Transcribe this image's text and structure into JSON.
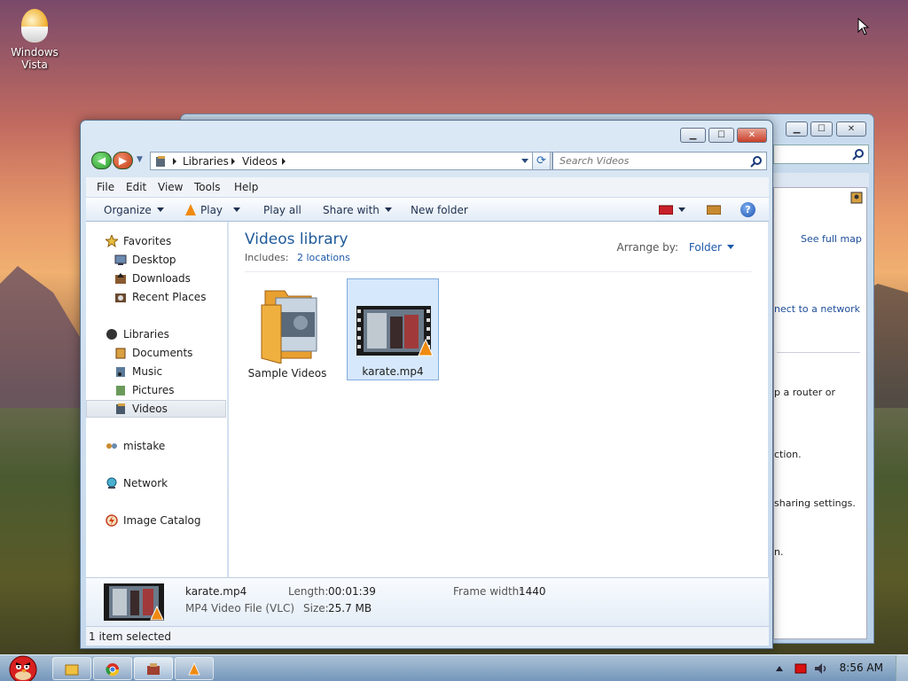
{
  "desktop": {
    "icons": [
      {
        "label": "Windows\nVista",
        "line1": "Windows",
        "line2": "Vista"
      }
    ]
  },
  "background_window": {
    "texts": [
      "See full map",
      "nect to a network",
      "p a router or",
      "ction.",
      "sharing settings.",
      "n."
    ]
  },
  "window": {
    "caption_buttons": {
      "minimize": "▁",
      "maximize": "☐",
      "close": "✕"
    },
    "address": {
      "crumbs": [
        "Libraries",
        "Videos"
      ]
    },
    "search": {
      "placeholder": "Search Videos"
    },
    "menu": [
      "File",
      "Edit",
      "View",
      "Tools",
      "Help"
    ],
    "toolbar": {
      "organize": "Organize",
      "play": "Play",
      "play_all": "Play all",
      "share_with": "Share with",
      "new_folder": "New folder",
      "help": "?"
    },
    "nav": {
      "favorites": "Favorites",
      "favorites_items": [
        "Desktop",
        "Downloads",
        "Recent Places"
      ],
      "libraries": "Libraries",
      "libraries_items": [
        "Documents",
        "Music",
        "Pictures",
        "Videos"
      ],
      "homegroup": "mistake",
      "network": "Network",
      "image_catalog": "Image Catalog"
    },
    "content": {
      "title": "Videos library",
      "includes_label": "Includes:",
      "includes_link": "2 locations",
      "arrange_label": "Arrange by:",
      "arrange_value": "Folder",
      "files": [
        {
          "name": "Sample Videos",
          "selected": false
        },
        {
          "name": "karate.mp4",
          "selected": true
        }
      ]
    },
    "details": {
      "name": "karate.mp4",
      "type": "MP4 Video File (VLC)",
      "length_label": "Length:",
      "length": "00:01:39",
      "size_label": "Size:",
      "size": "25.7 MB",
      "frame_width_label": "Frame width:",
      "frame_width": "1440"
    },
    "status": "1 item selected"
  },
  "taskbar": {
    "clock": "8:56 AM"
  },
  "colors": {
    "accent": "#1e5a9a",
    "selection": "#d6e8fb"
  }
}
